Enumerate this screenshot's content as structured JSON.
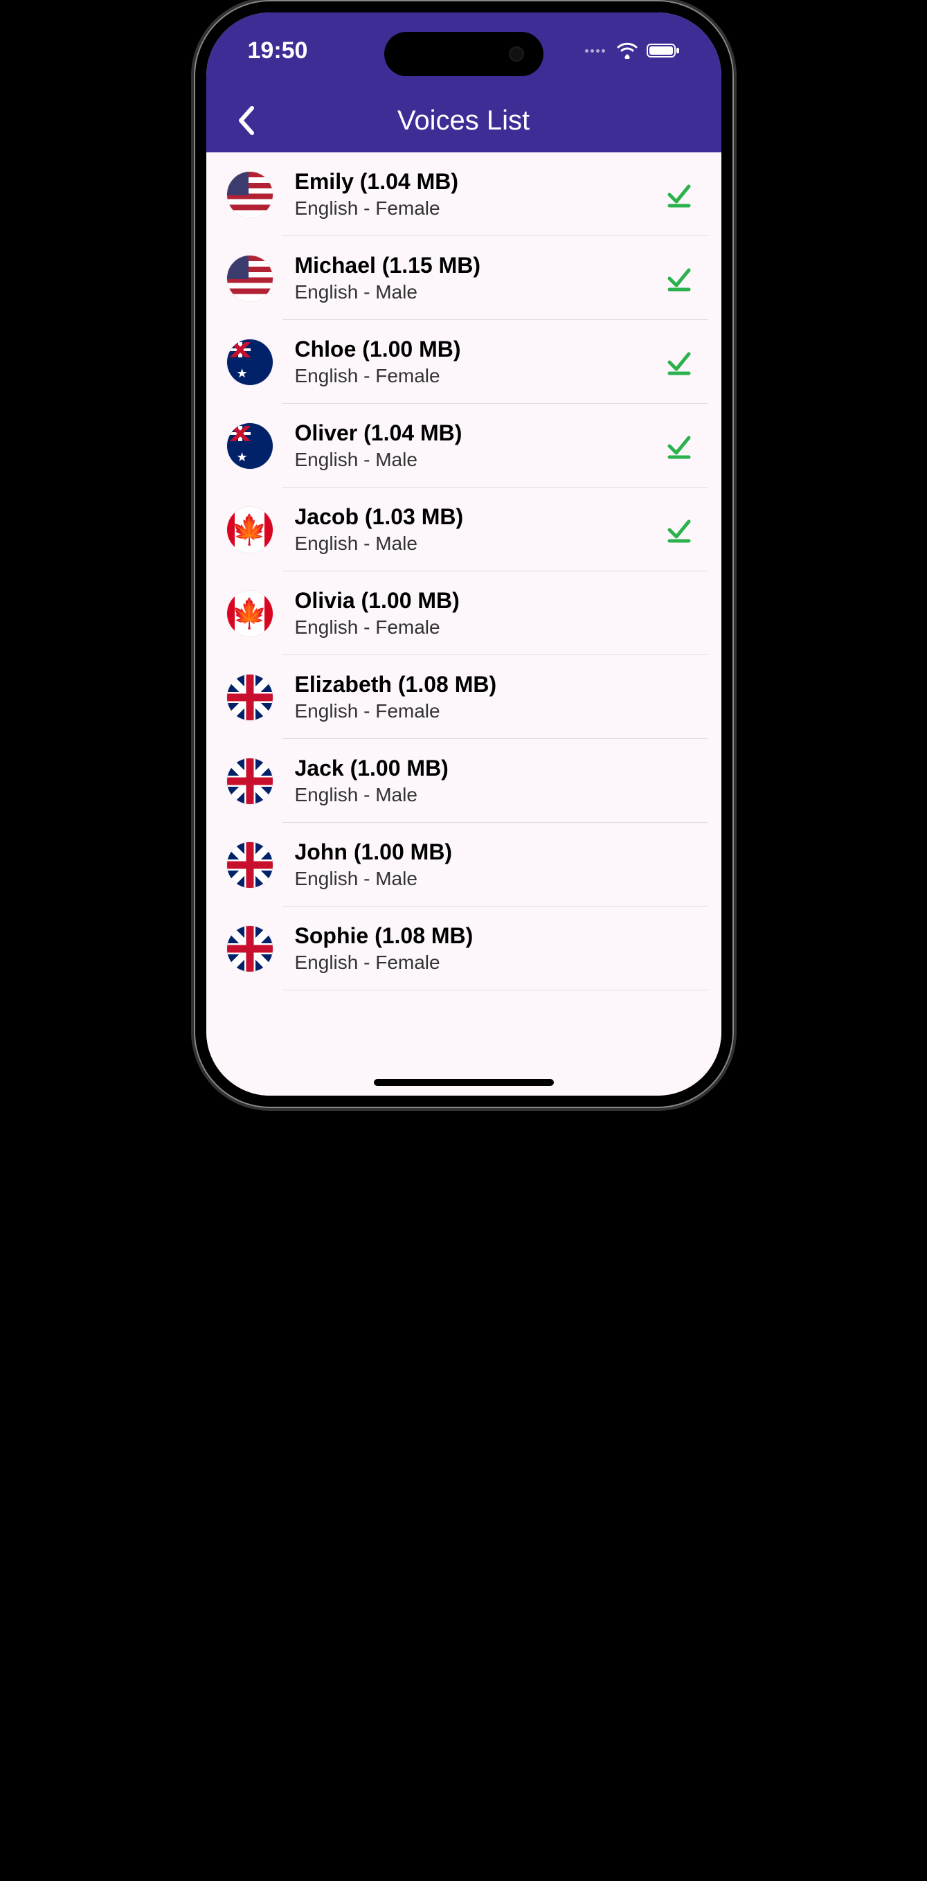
{
  "status": {
    "time": "19:50"
  },
  "nav": {
    "title": "Voices List"
  },
  "voices": [
    {
      "name": "Emily",
      "size": "1.04 MB",
      "lang": "English",
      "gender": "Female",
      "flag": "usa",
      "downloaded": true
    },
    {
      "name": "Michael",
      "size": "1.15 MB",
      "lang": "English",
      "gender": "Male",
      "flag": "usa",
      "downloaded": true
    },
    {
      "name": "Chloe",
      "size": "1.00 MB",
      "lang": "English",
      "gender": "Female",
      "flag": "aus",
      "downloaded": true
    },
    {
      "name": "Oliver",
      "size": "1.04 MB",
      "lang": "English",
      "gender": "Male",
      "flag": "aus",
      "downloaded": true
    },
    {
      "name": "Jacob",
      "size": "1.03 MB",
      "lang": "English",
      "gender": "Male",
      "flag": "can",
      "downloaded": true
    },
    {
      "name": "Olivia",
      "size": "1.00 MB",
      "lang": "English",
      "gender": "Female",
      "flag": "can",
      "downloaded": false
    },
    {
      "name": "Elizabeth",
      "size": "1.08 MB",
      "lang": "English",
      "gender": "Female",
      "flag": "uk",
      "downloaded": false
    },
    {
      "name": "Jack",
      "size": "1.00 MB",
      "lang": "English",
      "gender": "Male",
      "flag": "uk",
      "downloaded": false
    },
    {
      "name": "John",
      "size": "1.00 MB",
      "lang": "English",
      "gender": "Male",
      "flag": "uk",
      "downloaded": false
    },
    {
      "name": "Sophie",
      "size": "1.08 MB",
      "lang": "English",
      "gender": "Female",
      "flag": "uk",
      "downloaded": false
    }
  ]
}
